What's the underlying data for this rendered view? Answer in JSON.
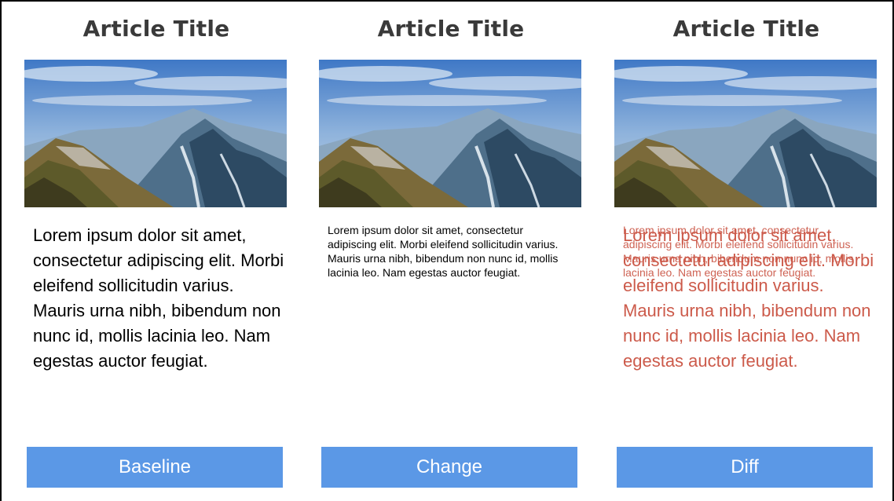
{
  "panels": [
    {
      "title": "Article Title",
      "image_alt": "mountain landscape photo",
      "body_large": "Lorem ipsum dolor sit amet, consectetur adipiscing elit. Morbi eleifend sollicitudin varius. Mauris urna nibh, bibendum non nunc id, mollis lacinia leo. Nam egestas auctor feugiat.",
      "button_label": "Baseline"
    },
    {
      "title": "Article Title",
      "image_alt": "mountain landscape photo",
      "body_small": "Lorem ipsum dolor sit amet, consectetur adipiscing elit. Morbi eleifend sollicitudin varius. Mauris urna nibh, bibendum non nunc id, mollis lacinia leo. Nam egestas auctor feugiat.",
      "button_label": "Change"
    },
    {
      "title": "Article Title",
      "image_alt": "mountain landscape photo",
      "body_large": "Lorem ipsum dolor sit amet, consectetur adipiscing elit. Morbi eleifend sollicitudin varius. Mauris urna nibh, bibendum non nunc id, mollis lacinia leo. Nam egestas auctor feugiat.",
      "body_small": "Lorem ipsum dolor sit amet, consectetur adipiscing elit. Morbi eleifend sollicitudin varius. Mauris urna nibh, bibendum non nunc id, mollis lacinia leo. Nam egestas auctor feugiat.",
      "button_label": "Diff"
    }
  ],
  "colors": {
    "button_bg": "#5b98e6",
    "button_text": "#ffffff",
    "diff_text": "#cc5a4a",
    "title_text": "#3a3a3a"
  }
}
